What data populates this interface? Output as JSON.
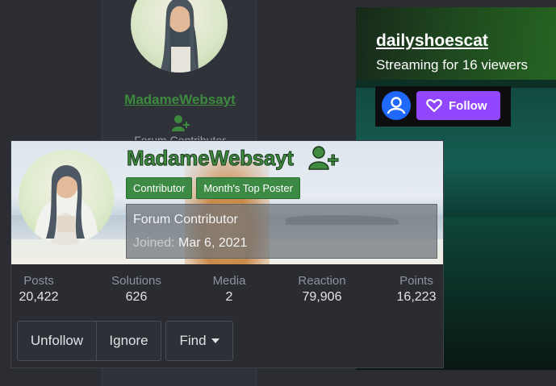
{
  "background_post": {
    "username": "MadameWebsayt",
    "subtitle": "Forum Contributor"
  },
  "stream": {
    "channel_name": "dailyshoescat",
    "status": "Streaming for 16 viewers",
    "follow_label": "Follow",
    "colors": {
      "follow_button": "#9147ff",
      "avatar": "#1f69ff"
    }
  },
  "member_card": {
    "username": "MadameWebsayt",
    "badges": [
      "Contributor",
      "Month's Top Poster"
    ],
    "title": "Forum Contributor",
    "joined_label": "Joined:",
    "joined_date": "Mar 6, 2021",
    "stats": [
      {
        "name": "Posts",
        "value": "20,422"
      },
      {
        "name": "Solutions",
        "value": "626"
      },
      {
        "name": "Media",
        "value": "2"
      },
      {
        "name": "Reaction",
        "value": "79,906"
      },
      {
        "name": "Points",
        "value": "16,223"
      }
    ],
    "buttons": {
      "unfollow": "Unfollow",
      "ignore": "Ignore",
      "find": "Find"
    },
    "colors": {
      "username": "#3e8a3e",
      "badge": "#3d8a45"
    }
  }
}
